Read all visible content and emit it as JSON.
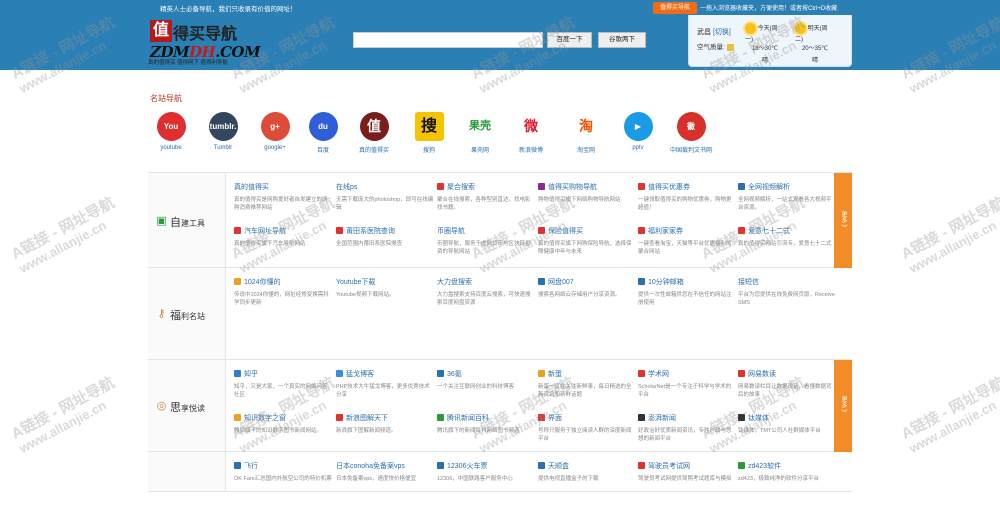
{
  "topbar": {
    "slogan": "精英人士必备导航，我们只收录有价值的网址！",
    "button": "值得买导航",
    "tip": "一拖入浏览器收藏夹，方便使用！或者按Ctrl+D收藏"
  },
  "logo": {
    "mark": "值",
    "name": "得买导航",
    "domain_a": "ZDM",
    "domain_b": "DH",
    "domain_c": ".COM",
    "subtitle": "真的值得买 值得网下 值得利导航"
  },
  "search": {
    "placeholder": "",
    "buttons": [
      "百度一下",
      "谷歌两下"
    ]
  },
  "weather": {
    "city": "武昌",
    "switch": "[切换]",
    "air_label": "空气质量:",
    "days": [
      {
        "label": "今天(周一)",
        "temp": "18～30℃",
        "state": "晴"
      },
      {
        "label": "明天(周二)",
        "temp": "20～35℃",
        "state": "晴"
      }
    ]
  },
  "site_nav": {
    "title": "名站导航",
    "items": [
      {
        "label": "youtube",
        "icon": "youtube-icon",
        "text": "You Tube",
        "color": "#e02d2d"
      },
      {
        "label": "Tumblr",
        "icon": "tumblr-icon",
        "text": "tumblr.",
        "color": "#34465d"
      },
      {
        "label": "google+",
        "icon": "google-plus-icon",
        "text": "g+",
        "color": "#dd4b39"
      },
      {
        "label": "百度",
        "icon": "baidu-icon",
        "text": "du",
        "color": "#2f5fd8"
      },
      {
        "label": "真的值得买",
        "icon": "zhide-icon",
        "text": "值",
        "color": "#7a1d1d"
      },
      {
        "label": "搜狗",
        "icon": "sogou-icon",
        "text": "搜",
        "color": "#f5c400"
      },
      {
        "label": "果壳网",
        "icon": "guokr-icon",
        "text": "果壳",
        "color": "#ffffff"
      },
      {
        "label": "新浪微博",
        "icon": "weibo-icon",
        "text": "微",
        "color": "#e6162d"
      },
      {
        "label": "淘宝网",
        "icon": "taobao-icon",
        "text": "淘",
        "color": "#ff5000"
      },
      {
        "label": "pptv",
        "icon": "pptv-icon",
        "text": "▶",
        "color": "#1a9be6"
      },
      {
        "label": "中国裁判文书网",
        "icon": "court-icon",
        "text": "徽",
        "color": "#d6312b"
      }
    ]
  },
  "categories": [
    {
      "name": "自",
      "rest": "建工具",
      "icon": "monitor-icon",
      "more": "更多 》",
      "items": [
        {
          "title": "真的值得买",
          "desc": "真的值得买是网购爱好者自发建立的网购消费推荐网站",
          "icon": "",
          "icolor": ""
        },
        {
          "title": "在线ps",
          "desc": "无需下载庞大的photoshop，即可在线编辑",
          "icon": "",
          "icolor": ""
        },
        {
          "title": "聚合搜索",
          "desc": "聚合在线搜索，各种型别直达，找电影找书籍。",
          "icon": "搜",
          "icolor": "#e0322f"
        },
        {
          "title": "值得买购物导航",
          "desc": "购物值得买旗下网络购物导航网站",
          "icon": "值",
          "icolor": "#8a2b8c"
        },
        {
          "title": "值得买优惠券",
          "desc": "一键领取值得买的购物优惠券，购物更超值！",
          "icon": "券",
          "icolor": "#e0322f"
        },
        {
          "title": "全网视频解析",
          "desc": "全网视频解析，一站式观看各大视频平台资源。",
          "icon": "V",
          "icolor": "#2a6fb0"
        },
        {
          "title": "汽车网址导航",
          "desc": "真的值得买旗下汽车导航网站",
          "icon": "车",
          "icolor": "#e0322f"
        },
        {
          "title": "莆田系医院查询",
          "desc": "全国范围内莆田系医院搜查",
          "icon": "医",
          "icolor": "#e0322f"
        },
        {
          "title": "币圈导航",
          "desc": "币圈导航，服务于虚拟货币与区块链投资的导航网站",
          "icon": "",
          "icolor": ""
        },
        {
          "title": "保险值得买",
          "desc": "真的值得买旗下网购保险导航，选择保障健康中年与未来",
          "icon": "保",
          "icolor": "#e0322f"
        },
        {
          "title": "福利家家券",
          "desc": "一键查看淘宝，天猫等平台优惠福利的聚合网站",
          "icon": "福",
          "icolor": "#e0322f"
        },
        {
          "title": "爱意七十二式",
          "desc": "真的值得买网站引流专，爱意七十二式",
          "icon": "爱",
          "icolor": "#e0322f"
        }
      ]
    },
    {
      "name": "福",
      "rest": "利名站",
      "icon": "key-icon",
      "more": "",
      "items": [
        {
          "title": "1024你懂的",
          "desc": "传说中1024你懂的，网址经常变换需科学同步更新",
          "icon": "▲",
          "icolor": "#f0a020"
        },
        {
          "title": "Youtube下载",
          "desc": "Youtube视频下载网站。",
          "icon": "",
          "icolor": ""
        },
        {
          "title": "大力盘搜索",
          "desc": "大力盘搜索支持百度云搜索，可快速搜索百度网盘资源",
          "icon": "",
          "icolor": ""
        },
        {
          "title": "网盘007",
          "desc": "搜索各网络云存储用户分享资源。",
          "icon": "盘",
          "icolor": "#2a6fb0"
        },
        {
          "title": "10分钟邮箱",
          "desc": "提供一次性邮箱供您在不信任的网站注册使用",
          "icon": "邮",
          "icolor": "#2a6fb0"
        },
        {
          "title": "接短信",
          "desc": "平台为您提供在线免费网页版，Receive SMS",
          "icon": "",
          "icolor": ""
        }
      ]
    },
    {
      "name": "思",
      "rest": "享悦读",
      "icon": "bulb-icon",
      "more": "更多 》",
      "items": [
        {
          "title": "知乎",
          "desc": "知乎，又是大家，一个真实的网络问答社区",
          "icon": "知",
          "icolor": "#2a7fd4"
        },
        {
          "title": "猛戈博客",
          "desc": "PHP技术大牛猛戈博客，更多优秀技术分享",
          "icon": "猛",
          "icolor": "#3a8ee0"
        },
        {
          "title": "36氪",
          "desc": "一个关注互联网创业的科技博客",
          "icon": "Kr",
          "icolor": "#2a6fb0"
        },
        {
          "title": "新蛋",
          "desc": "新蛋一直在关注新鲜事，每日精选的全新资讯和新鲜话题",
          "icon": "蛋",
          "icolor": "#f0a020"
        },
        {
          "title": "学术网",
          "desc": "ScholarNet是一个专注于科学与学术的平台",
          "icon": "学",
          "icolor": "#e0322f"
        },
        {
          "title": "网易数读",
          "desc": "网易数读栏目让数据说话，看懂数据背后的故事",
          "icon": "易",
          "icolor": "#e0322f"
        },
        {
          "title": "知识数字之窗",
          "desc": "搜狐旗下的知识数字图书新闻网站。",
          "icon": "知",
          "icolor": "#f0a020"
        },
        {
          "title": "新浪图解天下",
          "desc": "新浪旗下图解新闻频道。",
          "icon": "浪",
          "icolor": "#e0322f"
        },
        {
          "title": "腾讯新闻百科",
          "desc": "腾讯旗下的新闻百科网络图书频道",
          "icon": "腾",
          "icolor": "#2a9a3a"
        },
        {
          "title": "界面",
          "desc": "号称只服务于独立阅读人群的深度新闻平台",
          "icon": "界",
          "icolor": "#e0322f"
        },
        {
          "title": "澎湃新闻",
          "desc": "好政治好优质新闻资讯，专注时政与思想的新闻平台",
          "icon": "澎",
          "icolor": "#333333"
        },
        {
          "title": "钛媒体",
          "desc": "钛媒体，TMT公司人社群媒体平台",
          "icon": "钛",
          "icolor": "#333333"
        }
      ]
    },
    {
      "name": "",
      "rest": "",
      "icon": "",
      "more": "",
      "items": [
        {
          "title": "飞行",
          "desc": "OK Fare汇总国内外航空公司的特价机票",
          "icon": "OK",
          "icolor": "#2a6fb0"
        },
        {
          "title": "日本conoha免备案vps",
          "desc": "日本免备案vps，速度快价格便宜",
          "icon": "",
          "icolor": ""
        },
        {
          "title": "12306火车票",
          "desc": "12306，中国铁路客户服务中心",
          "icon": "铁",
          "icolor": "#2a6fb0"
        },
        {
          "title": "天顺盒",
          "desc": "提供电视直播盒子的下载",
          "icon": "天",
          "icolor": "#2a6fb0"
        },
        {
          "title": "驾驶员考试网",
          "desc": "驾驶员考试网提供驾照考试题库与模拟",
          "icon": "驾",
          "icolor": "#e0322f"
        },
        {
          "title": "zd423软件",
          "desc": "zd423，极致纯净的软件分享平台",
          "icon": "Z",
          "icolor": "#2a9a3a"
        }
      ]
    }
  ],
  "watermark": {
    "line1": "A链接 - 网址导航",
    "line2": "www.allanjie.cn"
  }
}
